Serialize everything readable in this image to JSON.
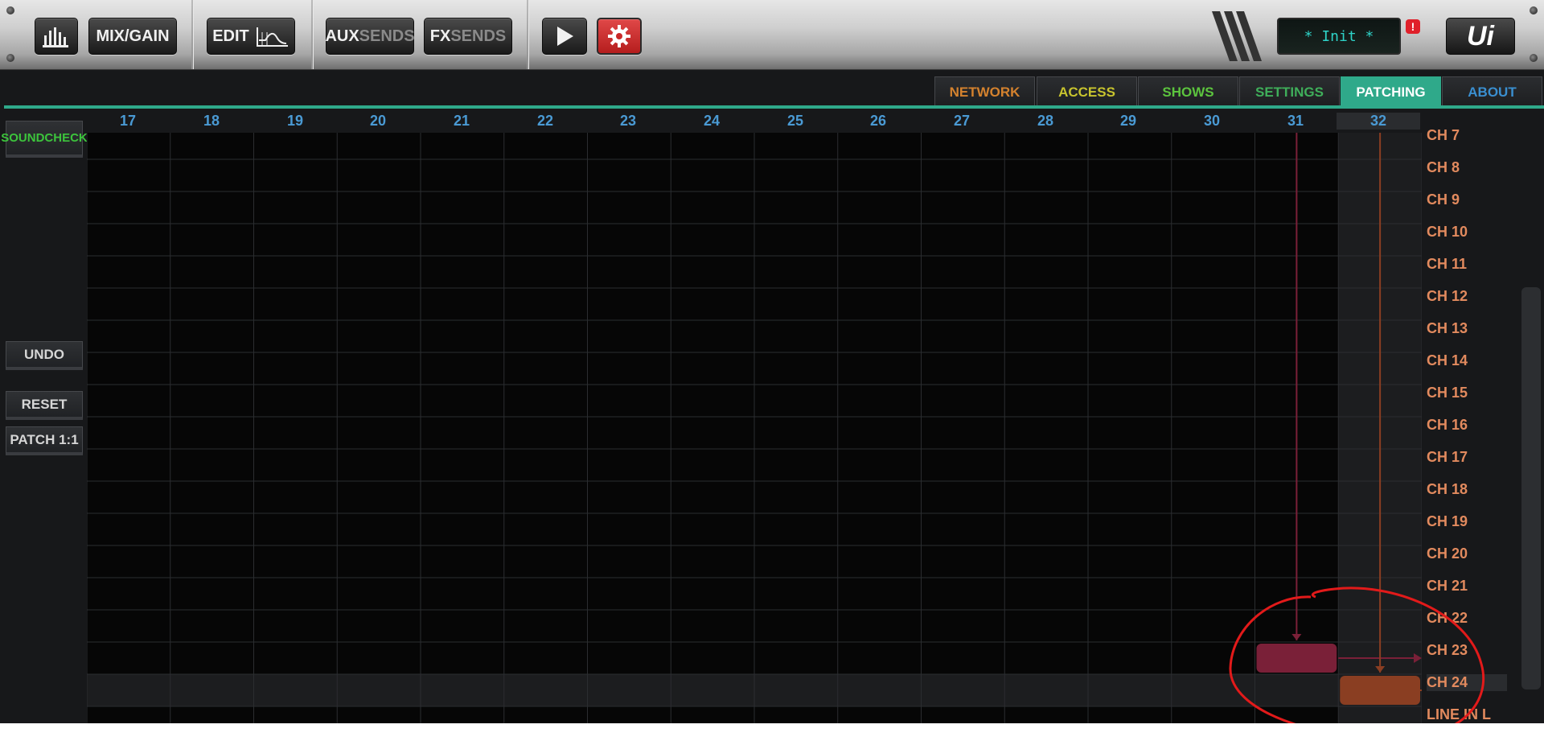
{
  "toolbar": {
    "meters_icon": "meters-icon",
    "mix_gain_label": "MIX/GAIN",
    "edit_label": "EDIT",
    "aux_sends_bold": "AUX",
    "aux_sends_dim": "SENDS",
    "fx_sends_bold": "FX",
    "fx_sends_dim": "SENDS",
    "play_icon": "play-icon",
    "settings_icon": "gear-icon",
    "show_name": "* Init *",
    "alert_badge": "!",
    "logo": "Ui"
  },
  "tabs": [
    {
      "label": "NETWORK",
      "color": "#d4822e"
    },
    {
      "label": "ACCESS",
      "color": "#c8c42e"
    },
    {
      "label": "SHOWS",
      "color": "#5cc43e"
    },
    {
      "label": "SETTINGS",
      "color": "#3fae5a"
    },
    {
      "label": "PATCHING",
      "color": "#ffffff",
      "active": true
    },
    {
      "label": "ABOUT",
      "color": "#3a8fd0"
    }
  ],
  "sidebar": {
    "soundcheck": "SOUNDCHECK",
    "soundcheck_color": "#3cc43c",
    "undo": "UNDO",
    "reset": "RESET",
    "patch_1_1": "PATCH 1:1"
  },
  "columns": [
    "17",
    "18",
    "19",
    "20",
    "21",
    "22",
    "23",
    "24",
    "25",
    "26",
    "27",
    "28",
    "29",
    "30",
    "31",
    "32"
  ],
  "rows": [
    "CH 7",
    "CH 8",
    "CH 9",
    "CH 10",
    "CH 11",
    "CH 12",
    "CH 13",
    "CH 14",
    "CH 15",
    "CH 16",
    "CH 17",
    "CH 18",
    "CH 19",
    "CH 20",
    "CH 21",
    "CH 22",
    "CH 23",
    "CH 24",
    "LINE IN L"
  ],
  "patches": [
    {
      "column": "31",
      "row": "CH 23",
      "color": "#7a2038"
    },
    {
      "column": "32",
      "row": "CH 24",
      "color": "#8a3e22"
    }
  ],
  "highlighted_column": "32",
  "highlighted_row": "CH 24",
  "colors": {
    "accent": "#2fa98a",
    "column_number": "#4a9ad4",
    "row_label": "#e28a5e",
    "annotation": "#e21a1a"
  }
}
